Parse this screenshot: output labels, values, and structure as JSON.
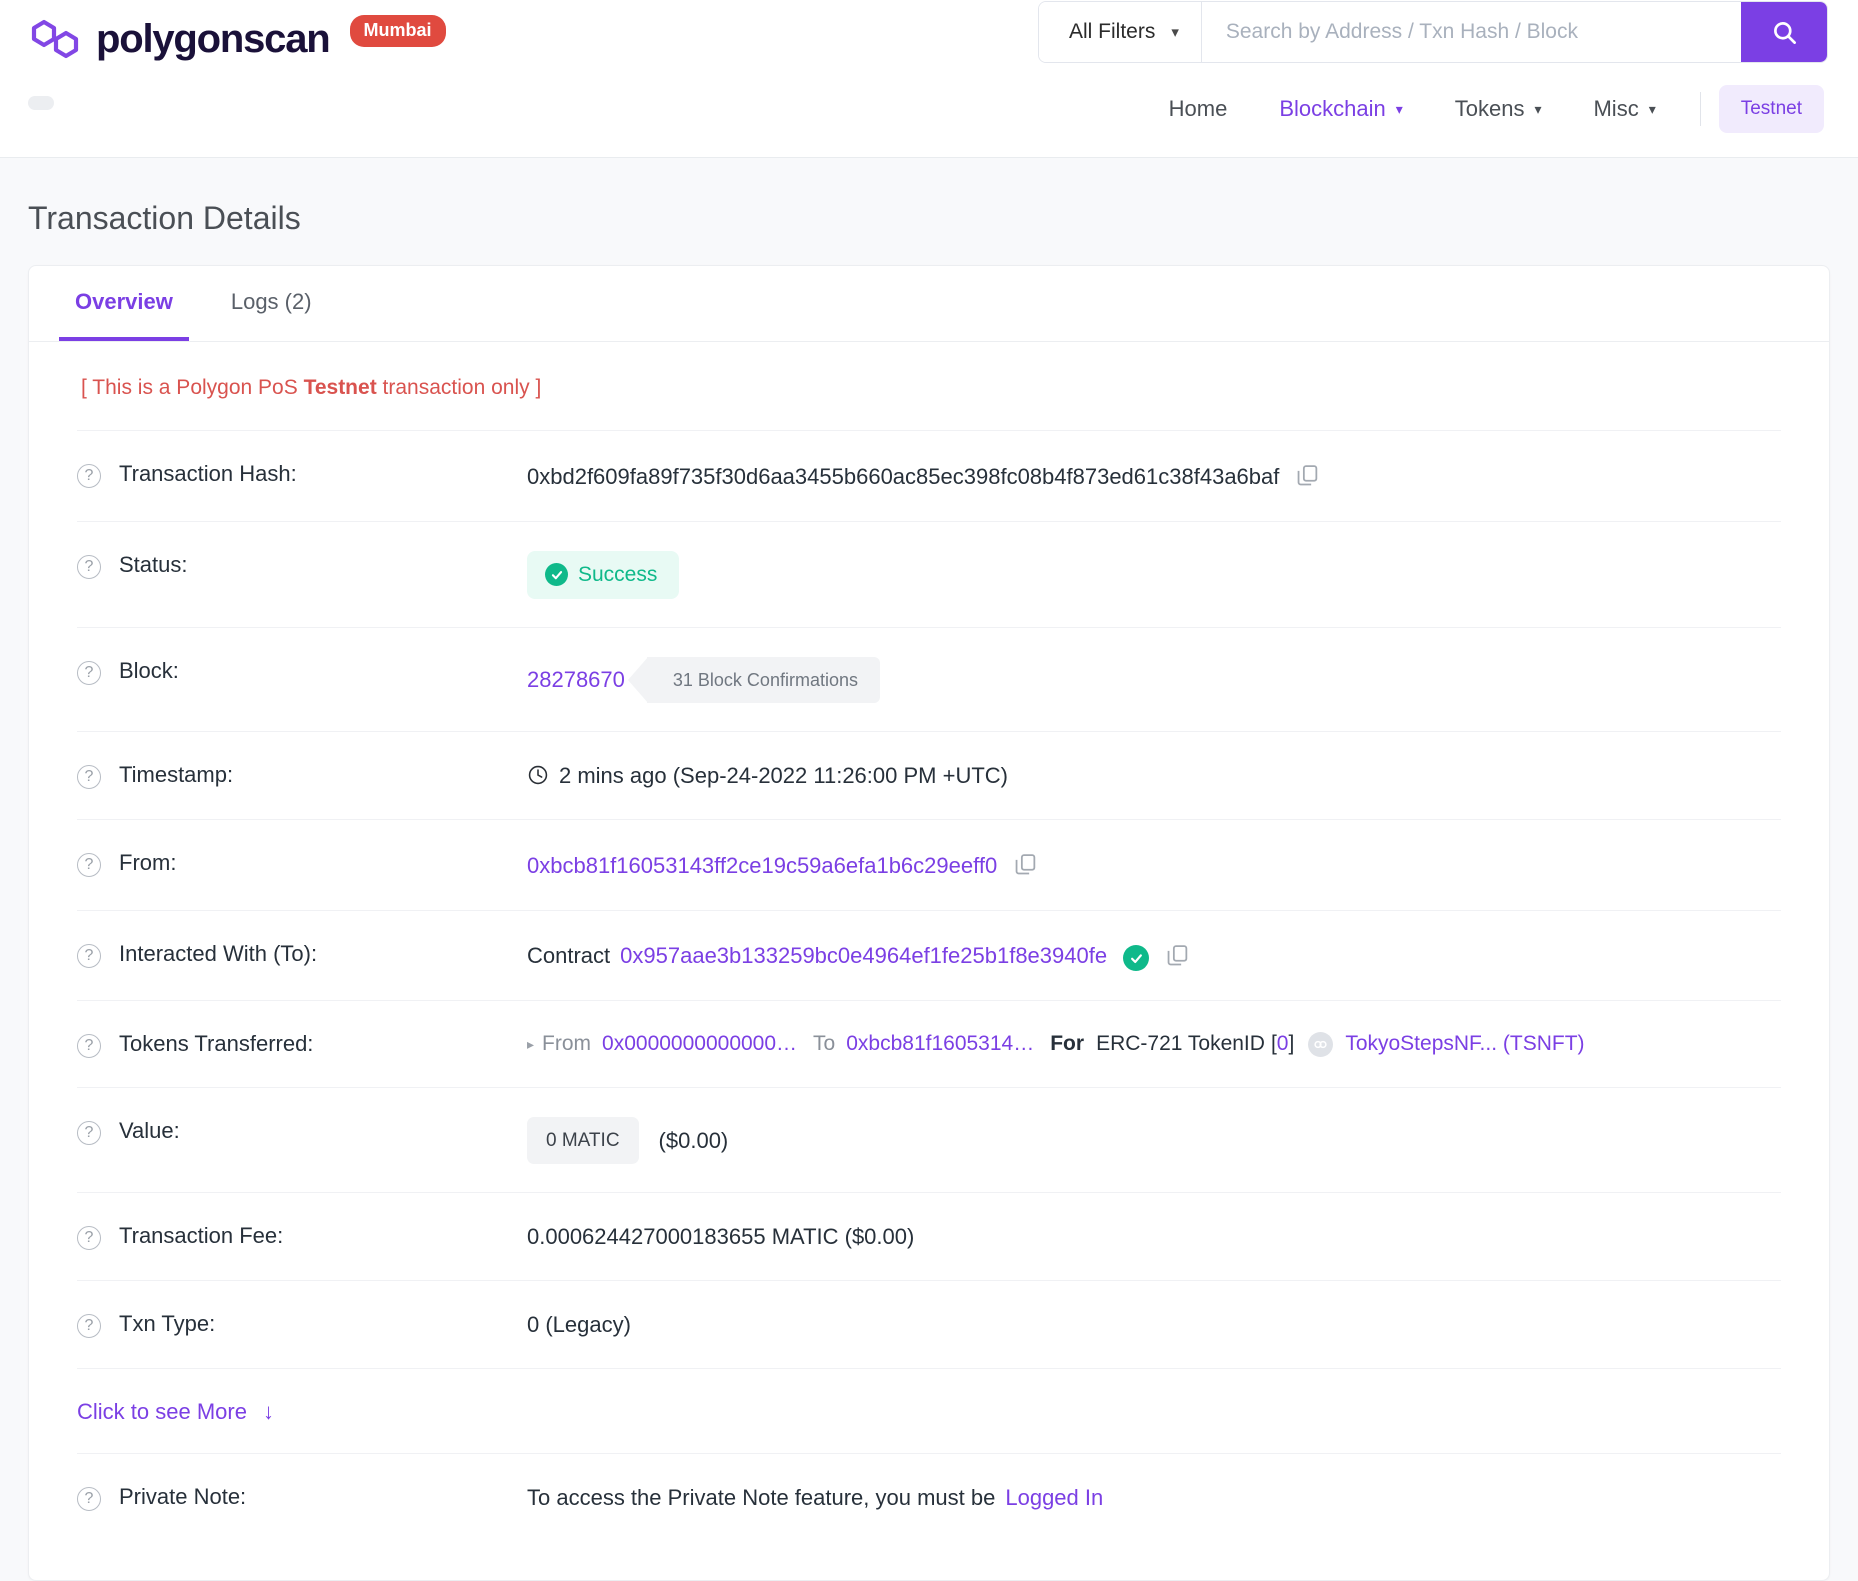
{
  "header": {
    "brand_name": "polygonscan",
    "network_badge": "Mumbai",
    "search": {
      "filter_label": "All Filters",
      "placeholder": "Search by Address / Txn Hash / Block",
      "value": "",
      "caret": "⌄",
      "search_icon": "search-icon"
    },
    "nav": [
      {
        "label": "Home",
        "has_caret": false,
        "active": false
      },
      {
        "label": "Blockchain",
        "has_caret": true,
        "active": true
      },
      {
        "label": "Tokens",
        "has_caret": true,
        "active": false
      },
      {
        "label": "Misc",
        "has_caret": true,
        "active": false
      }
    ],
    "network_button": "Testnet"
  },
  "page": {
    "title": "Transaction Details",
    "tabs": [
      {
        "label": "Overview",
        "active": true
      },
      {
        "label": "Logs (2)",
        "active": false
      }
    ],
    "testnet_notice": {
      "prefix": "[ This is a Polygon PoS ",
      "bold": "Testnet",
      "suffix": " transaction only ]"
    }
  },
  "transaction": {
    "hash": {
      "label": "Transaction Hash:",
      "value": "0xbd2f609fa89f735f30d6aa3455b660ac85ec398fc08b4f873ed61c38f43a6baf"
    },
    "status": {
      "label": "Status:",
      "value": "Success"
    },
    "block": {
      "label": "Block:",
      "number": "28278670",
      "confirmations": "31 Block Confirmations"
    },
    "timestamp": {
      "label": "Timestamp:",
      "value": "2 mins ago (Sep-24-2022 11:26:00 PM +UTC)"
    },
    "from": {
      "label": "From:",
      "address": "0xbcb81f16053143ff2ce19c59a6efa1b6c29eeff0"
    },
    "to": {
      "label": "Interacted With (To):",
      "prefix": "Contract",
      "address": "0x957aae3b133259bc0e4964ef1fe25b1f8e3940fe"
    },
    "tokens_transferred": {
      "label": "Tokens Transferred:",
      "from_word": "From",
      "from_address": "0x0000000000000…",
      "to_word": "To",
      "to_address": "0xbcb81f1605314…",
      "for_word": "For",
      "standard": "ERC-721 TokenID",
      "token_id": "0",
      "token_name": "TokyoStepsNF... (TSNFT)"
    },
    "value": {
      "label": "Value:",
      "amount": "0 MATIC",
      "fiat": "($0.00)"
    },
    "fee": {
      "label": "Transaction Fee:",
      "value": "0.000624427000183655 MATIC ($0.00)"
    },
    "txn_type": {
      "label": "Txn Type:",
      "value": "0 (Legacy)"
    },
    "see_more": {
      "label": "Click to see More",
      "arrow": "↓"
    },
    "private_note": {
      "label": "Private Note:",
      "text": "To access the Private Note feature, you must be",
      "link": "Logged In"
    }
  },
  "colors": {
    "accent": "#7b3fe4",
    "success": "#0fb98a",
    "danger": "#d9534f",
    "badge": "#e04a3f"
  }
}
